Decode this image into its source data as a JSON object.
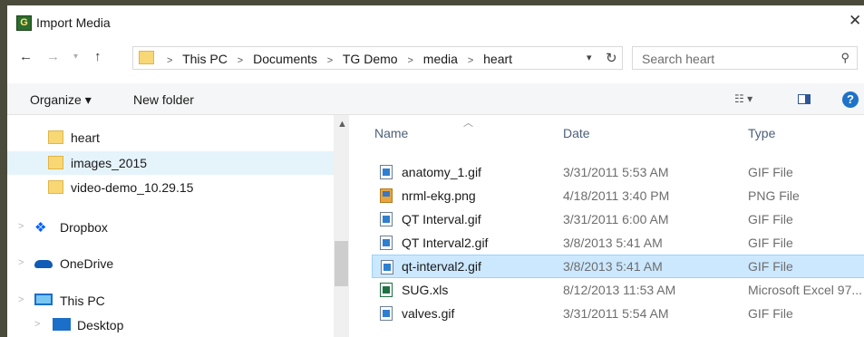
{
  "window": {
    "title": "Import Media",
    "app_icon_letter": "G",
    "close_glyph": "✕"
  },
  "nav": {
    "breadcrumbs": [
      "This PC",
      "Documents",
      "TG Demo",
      "media",
      "heart"
    ],
    "search_placeholder": "Search heart"
  },
  "toolbar": {
    "organize_label": "Organize ▾",
    "new_folder_label": "New folder"
  },
  "sidebar": {
    "items": [
      {
        "label": "heart"
      },
      {
        "label": "images_2015"
      },
      {
        "label": "video-demo_10.29.15"
      },
      {
        "label": "Dropbox"
      },
      {
        "label": "OneDrive"
      },
      {
        "label": "This PC"
      },
      {
        "label": "Desktop"
      }
    ]
  },
  "columns": {
    "name": "Name",
    "date": "Date",
    "type": "Type"
  },
  "files": [
    {
      "name": "anatomy_1.gif",
      "date": "3/31/2011 5:53 AM",
      "type": "GIF File",
      "icon": "gif-icon"
    },
    {
      "name": "nrml-ekg.png",
      "date": "4/18/2011 3:40 PM",
      "type": "PNG File",
      "icon": "png-icon"
    },
    {
      "name": "QT Interval.gif",
      "date": "3/31/2011 6:00 AM",
      "type": "GIF File",
      "icon": "gif-icon"
    },
    {
      "name": "QT Interval2.gif",
      "date": "3/8/2013 5:41 AM",
      "type": "GIF File",
      "icon": "gif-icon"
    },
    {
      "name": "qt-interval2.gif",
      "date": "3/8/2013 5:41 AM",
      "type": "GIF File",
      "icon": "gif-icon",
      "selected": true
    },
    {
      "name": "SUG.xls",
      "date": "8/12/2013 11:53 AM",
      "type": "Microsoft Excel 97...",
      "icon": "xls-icon"
    },
    {
      "name": "valves.gif",
      "date": "3/31/2011 5:54 AM",
      "type": "GIF File",
      "icon": "gif-icon"
    }
  ],
  "colors": {
    "selection": "#cce8ff",
    "hover": "#e5f3fb",
    "background": "#4b4b3c"
  }
}
